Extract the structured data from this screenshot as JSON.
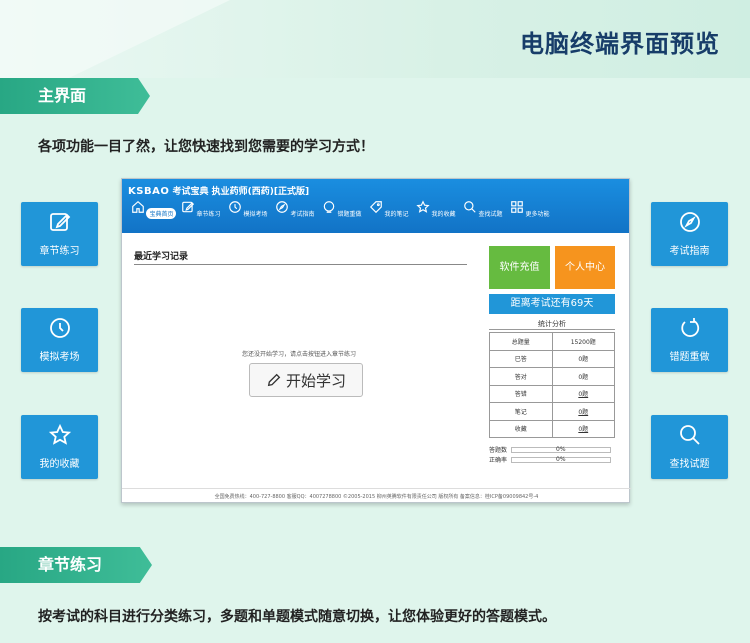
{
  "page_title": "电脑终端界面预览",
  "section1": {
    "title": "主界面",
    "description": "各项功能一目了然，让您快速找到您需要的学习方式！"
  },
  "section2": {
    "title": "章节练习",
    "description": "按考试的科目进行分类练习，多题和单题模式随意切换，让您体验更好的答题模式。"
  },
  "side_left": [
    {
      "label": "章节练习",
      "icon": "edit-icon"
    },
    {
      "label": "模拟考场",
      "icon": "clock-icon"
    },
    {
      "label": "我的收藏",
      "icon": "star-icon"
    }
  ],
  "side_right": [
    {
      "label": "考试指南",
      "icon": "compass-icon"
    },
    {
      "label": "错题重做",
      "icon": "redo-icon"
    },
    {
      "label": "查找试题",
      "icon": "search-icon"
    }
  ],
  "app": {
    "brand": "KSBAO",
    "brand_sub": "考试宝典",
    "subject": "执业药师(西药)[正式版]",
    "nav": [
      {
        "label": "宝典首页",
        "icon": "home-icon"
      },
      {
        "label": "章节练习",
        "icon": "edit-icon"
      },
      {
        "label": "模拟考场",
        "icon": "clock-icon"
      },
      {
        "label": "考试指南",
        "icon": "compass-icon"
      },
      {
        "label": "错题重做",
        "icon": "redo-icon"
      },
      {
        "label": "我的笔记",
        "icon": "tag-icon"
      },
      {
        "label": "我的收藏",
        "icon": "star-icon"
      },
      {
        "label": "查找试题",
        "icon": "search-icon"
      },
      {
        "label": "更多功能",
        "icon": "grid-icon"
      }
    ],
    "recent_title": "最近学习记录",
    "empty_message": "您还没开始学习，请点击按钮进入章节练习",
    "start_button": "开始学习",
    "charge_button": "软件充值",
    "user_center_button": "个人中心",
    "exam_countdown": "距离考试还有69天",
    "stats_title": "统计分析",
    "stats": [
      [
        "总题量",
        "15200题"
      ],
      [
        "已答",
        "0题"
      ],
      [
        "答对",
        "0题"
      ],
      [
        "答错",
        "0题"
      ],
      [
        "笔记",
        "0题"
      ],
      [
        "收藏",
        "0题"
      ]
    ],
    "answer_rate_label": "答题数",
    "answer_rate_value": "0%",
    "correct_rate_label": "正确率",
    "correct_rate_value": "0%",
    "footer": "全国免费热线：400-727-8800  客服QQ：4007278800  ©2005-2015  柳州英腾软件有限责任公司 版权所有  备案信息：桂ICP备09009842号-4"
  },
  "colors": {
    "accent_blue": "#2196d8",
    "ribbon_green": "#28a784",
    "charge_green": "#66bb40",
    "center_orange": "#f6941e",
    "title_navy": "#173d69"
  }
}
